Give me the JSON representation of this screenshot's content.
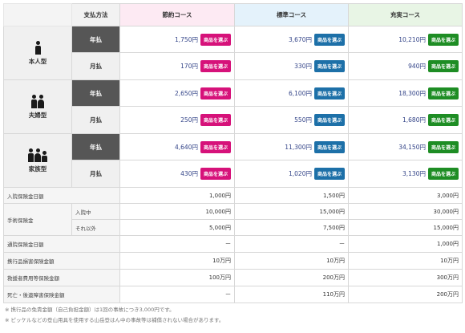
{
  "header": {
    "pay_method": "支払方法",
    "courses": [
      "節約コース",
      "標準コース",
      "充実コース"
    ]
  },
  "button_label": "商品を選ぶ",
  "plans": [
    {
      "type": "本人型",
      "icon": "single-person-icon",
      "rows": [
        {
          "pay": "年払",
          "prices": [
            "1,750円",
            "3,670円",
            "10,210円"
          ]
        },
        {
          "pay": "月払",
          "prices": [
            "170円",
            "330円",
            "940円"
          ]
        }
      ]
    },
    {
      "type": "夫婦型",
      "icon": "couple-icon",
      "rows": [
        {
          "pay": "年払",
          "prices": [
            "2,650円",
            "6,100円",
            "18,300円"
          ]
        },
        {
          "pay": "月払",
          "prices": [
            "250円",
            "550円",
            "1,680円"
          ]
        }
      ]
    },
    {
      "type": "家族型",
      "icon": "family-icon",
      "rows": [
        {
          "pay": "年払",
          "prices": [
            "4,640円",
            "11,300円",
            "34,150円"
          ]
        },
        {
          "pay": "月払",
          "prices": [
            "430円",
            "1,020円",
            "3,130円"
          ]
        }
      ]
    }
  ],
  "benefits": [
    {
      "label": "入院保険金日額",
      "values": [
        "1,000円",
        "1,500円",
        "3,000円"
      ]
    },
    {
      "label": "手術保険金",
      "sub": "入院中",
      "values": [
        "10,000円",
        "15,000円",
        "30,000円"
      ]
    },
    {
      "sub": "それ以外",
      "values": [
        "5,000円",
        "7,500円",
        "15,000円"
      ]
    },
    {
      "label": "通院保険金日額",
      "values": [
        "ー",
        "ー",
        "1,000円"
      ]
    },
    {
      "label": "携行品損害保険金額",
      "values": [
        "10万円",
        "10万円",
        "10万円"
      ]
    },
    {
      "label": "救援者費用等保険金額",
      "values": [
        "100万円",
        "200万円",
        "300万円"
      ]
    },
    {
      "label": "死亡・後遺障害保険金額",
      "values": [
        "ー",
        "110万円",
        "200万円"
      ]
    }
  ],
  "notes": [
    "※ 携行品の免責金額（自己負担金額）は1回の事故につき3,000円です。",
    "※ ピッケルなどの登山用具を使用する山岳登はん中の事故等は補償されない場合があります。"
  ],
  "colors": {
    "pink": "#d6127a",
    "blue": "#1d70a8",
    "green": "#1e8d24",
    "pay_annual_bg": "#565656"
  }
}
